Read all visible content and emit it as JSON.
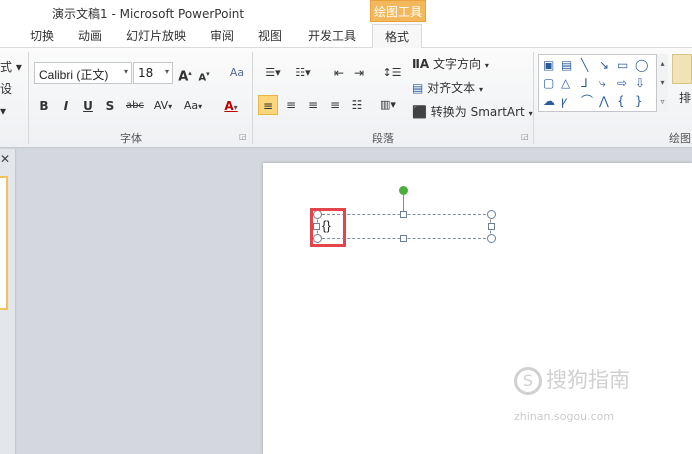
{
  "window": {
    "title": "演示文稿1 - Microsoft PowerPoint",
    "context_tab_group": "绘图工具"
  },
  "tabs": [
    {
      "label": "切换"
    },
    {
      "label": "动画"
    },
    {
      "label": "幻灯片放映"
    },
    {
      "label": "审阅"
    },
    {
      "label": "视图"
    },
    {
      "label": "开发工具"
    },
    {
      "label": "格式",
      "active": true
    }
  ],
  "ribbon": {
    "partial_left": [
      "式 ▾",
      "设",
      "▾"
    ],
    "font": {
      "family": "Calibri (正文)",
      "size": "18",
      "grow_label": "A",
      "shrink_label": "A",
      "clear_label": "Aa",
      "bold": "B",
      "italic": "I",
      "underline": "U",
      "shadow": "S",
      "strike": "abc",
      "spacing": "AV",
      "case": "Aa",
      "color": "A",
      "group_label": "字体"
    },
    "paragraph": {
      "text_direction": "文字方向",
      "align_text": "对齐文本",
      "convert_smartart": "转换为 SmartArt",
      "group_label": "段落"
    },
    "drawing": {
      "arrange_partial": "排",
      "group_label_partial": "绘图"
    }
  },
  "slide": {
    "textbox_text": "{}"
  },
  "watermark": {
    "main": "搜狗指南",
    "sub": "zhinan.sogou.com"
  },
  "colors": {
    "highlight": "#e3454a",
    "context_tab": "#f3b85c",
    "rotate_handle": "#4cae3a",
    "selected_button": "#fcd67a"
  }
}
